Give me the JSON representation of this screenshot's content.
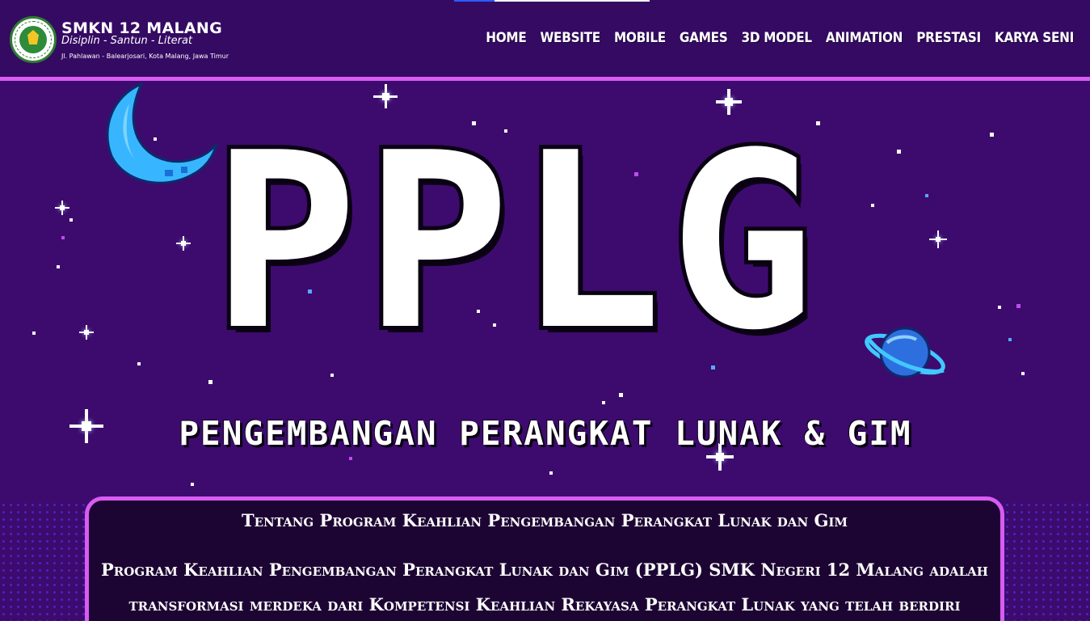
{
  "header": {
    "school_name": "SMKN 12 MALANG",
    "motto": "Disiplin - Santun - Literat",
    "address": "Jl. Pahlawan - Balearjosari, Kota Malang, Jawa Timur"
  },
  "nav": {
    "items": [
      "HOME",
      "WEBSITE",
      "MOBILE",
      "GAMES",
      "3D MODEL",
      "ANIMATION",
      "PRESTASI",
      "KARYA SENI"
    ]
  },
  "hero": {
    "title": "PPLG",
    "subtitle": "PENGEMBANGAN PERANGKAT LUNAK & GIM"
  },
  "about": {
    "heading": "Tentang Program Keahlian Pengembangan Perangkat Lunak dan Gim",
    "body": "Program Keahlian Pengembangan Perangkat Lunak dan Gim (PPLG) SMK Negeri 12 Malang adalah transformasi merdeka dari Kompetensi Keahlian Rekayasa Perangkat Lunak yang telah berdiri"
  },
  "colors": {
    "background": "#3d0b6e",
    "accent_border": "#d85cf2",
    "card_background": "#1d0533",
    "moon": "#37b6ff",
    "planet": "#2e8bff"
  },
  "icons": {
    "moon": "crescent-moon-icon",
    "planet": "ringed-planet-icon",
    "sparkle": "sparkle-star-icon"
  }
}
